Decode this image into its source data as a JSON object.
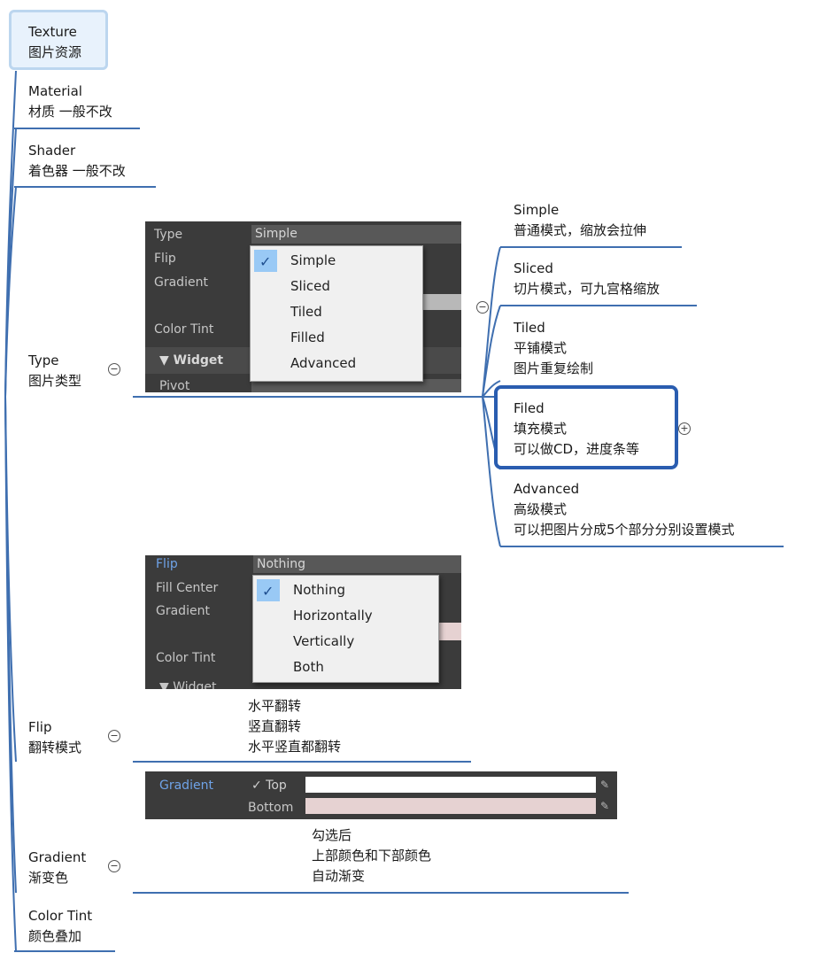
{
  "nodes": {
    "texture": {
      "title": "Texture",
      "sub": "图片资源"
    },
    "material": {
      "title": "Material",
      "sub": "材质 一般不改"
    },
    "shader": {
      "title": "Shader",
      "sub": "着色器 一般不改"
    },
    "type": {
      "title": "Type",
      "sub": "图片类型"
    },
    "flip": {
      "title": "Flip",
      "sub": "翻转模式"
    },
    "gradient": {
      "title": "Gradient",
      "sub": "渐变色"
    },
    "color_tint": {
      "title": "Color Tint",
      "sub": "颜色叠加"
    }
  },
  "type_children": {
    "simple": {
      "title": "Simple",
      "sub": "普通模式，缩放会拉伸"
    },
    "sliced": {
      "title": "Sliced",
      "sub": "切片模式，可九宫格缩放"
    },
    "tiled": {
      "title": "Tiled",
      "line1": "平铺模式",
      "line2": "图片重复绘制"
    },
    "filed": {
      "title": "Filed",
      "line1": "填充模式",
      "line2": "可以做CD，进度条等"
    },
    "advanced": {
      "title": "Advanced",
      "line1": "高级模式",
      "line2": "可以把图片分成5个部分分别设置模式"
    }
  },
  "flip_notes": {
    "line1": "水平翻转",
    "line2": "竖直翻转",
    "line3": "水平竖直都翻转"
  },
  "gradient_notes": {
    "line1": "勾选后",
    "line2": "上部颜色和下部颜色",
    "line3": "自动渐变"
  },
  "type_panel": {
    "labels": {
      "type": "Type",
      "flip": "Flip",
      "gradient": "Gradient",
      "color_tint": "Color Tint",
      "widget": "▼ Widget",
      "pivot": "Pivot"
    },
    "field_value": "Simple",
    "options": [
      "Simple",
      "Sliced",
      "Tiled",
      "Filled",
      "Advanced"
    ],
    "selected": "Simple"
  },
  "flip_panel": {
    "labels": {
      "flip": "Flip",
      "fill_center": "Fill Center",
      "gradient": "Gradient",
      "color_tint": "Color Tint",
      "widget": "▼ Widget"
    },
    "field_value": "Nothing",
    "options": [
      "Nothing",
      "Horizontally",
      "Vertically",
      "Both"
    ],
    "selected": "Nothing"
  },
  "gradient_panel": {
    "label": "Gradient",
    "top_label": "✓ Top",
    "bottom_label": "Bottom",
    "top_color": "#ffffff",
    "bottom_color": "#e6d2d2"
  },
  "colors": {
    "line": "#3f6fb0",
    "highlight_border": "#2a5db0",
    "selection": "#99c9f5"
  }
}
